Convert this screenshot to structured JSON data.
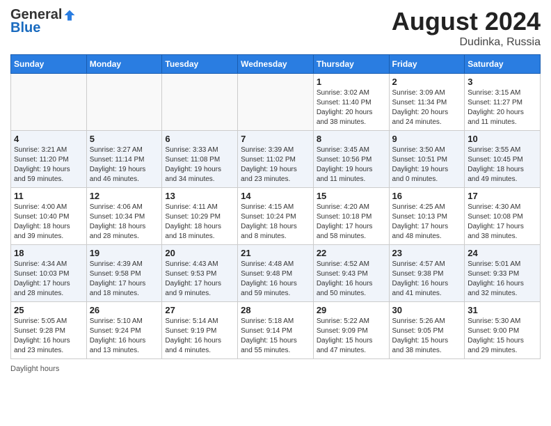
{
  "header": {
    "logo_general": "General",
    "logo_blue": "Blue",
    "month_year": "August 2024",
    "location": "Dudinka, Russia"
  },
  "days": [
    "Sunday",
    "Monday",
    "Tuesday",
    "Wednesday",
    "Thursday",
    "Friday",
    "Saturday"
  ],
  "weeks": [
    [
      {
        "date": "",
        "info": ""
      },
      {
        "date": "",
        "info": ""
      },
      {
        "date": "",
        "info": ""
      },
      {
        "date": "",
        "info": ""
      },
      {
        "date": "1",
        "info": "Sunrise: 3:02 AM\nSunset: 11:40 PM\nDaylight: 20 hours\nand 38 minutes."
      },
      {
        "date": "2",
        "info": "Sunrise: 3:09 AM\nSunset: 11:34 PM\nDaylight: 20 hours\nand 24 minutes."
      },
      {
        "date": "3",
        "info": "Sunrise: 3:15 AM\nSunset: 11:27 PM\nDaylight: 20 hours\nand 11 minutes."
      }
    ],
    [
      {
        "date": "4",
        "info": "Sunrise: 3:21 AM\nSunset: 11:20 PM\nDaylight: 19 hours\nand 59 minutes."
      },
      {
        "date": "5",
        "info": "Sunrise: 3:27 AM\nSunset: 11:14 PM\nDaylight: 19 hours\nand 46 minutes."
      },
      {
        "date": "6",
        "info": "Sunrise: 3:33 AM\nSunset: 11:08 PM\nDaylight: 19 hours\nand 34 minutes."
      },
      {
        "date": "7",
        "info": "Sunrise: 3:39 AM\nSunset: 11:02 PM\nDaylight: 19 hours\nand 23 minutes."
      },
      {
        "date": "8",
        "info": "Sunrise: 3:45 AM\nSunset: 10:56 PM\nDaylight: 19 hours\nand 11 minutes."
      },
      {
        "date": "9",
        "info": "Sunrise: 3:50 AM\nSunset: 10:51 PM\nDaylight: 19 hours\nand 0 minutes."
      },
      {
        "date": "10",
        "info": "Sunrise: 3:55 AM\nSunset: 10:45 PM\nDaylight: 18 hours\nand 49 minutes."
      }
    ],
    [
      {
        "date": "11",
        "info": "Sunrise: 4:00 AM\nSunset: 10:40 PM\nDaylight: 18 hours\nand 39 minutes."
      },
      {
        "date": "12",
        "info": "Sunrise: 4:06 AM\nSunset: 10:34 PM\nDaylight: 18 hours\nand 28 minutes."
      },
      {
        "date": "13",
        "info": "Sunrise: 4:11 AM\nSunset: 10:29 PM\nDaylight: 18 hours\nand 18 minutes."
      },
      {
        "date": "14",
        "info": "Sunrise: 4:15 AM\nSunset: 10:24 PM\nDaylight: 18 hours\nand 8 minutes."
      },
      {
        "date": "15",
        "info": "Sunrise: 4:20 AM\nSunset: 10:18 PM\nDaylight: 17 hours\nand 58 minutes."
      },
      {
        "date": "16",
        "info": "Sunrise: 4:25 AM\nSunset: 10:13 PM\nDaylight: 17 hours\nand 48 minutes."
      },
      {
        "date": "17",
        "info": "Sunrise: 4:30 AM\nSunset: 10:08 PM\nDaylight: 17 hours\nand 38 minutes."
      }
    ],
    [
      {
        "date": "18",
        "info": "Sunrise: 4:34 AM\nSunset: 10:03 PM\nDaylight: 17 hours\nand 28 minutes."
      },
      {
        "date": "19",
        "info": "Sunrise: 4:39 AM\nSunset: 9:58 PM\nDaylight: 17 hours\nand 18 minutes."
      },
      {
        "date": "20",
        "info": "Sunrise: 4:43 AM\nSunset: 9:53 PM\nDaylight: 17 hours\nand 9 minutes."
      },
      {
        "date": "21",
        "info": "Sunrise: 4:48 AM\nSunset: 9:48 PM\nDaylight: 16 hours\nand 59 minutes."
      },
      {
        "date": "22",
        "info": "Sunrise: 4:52 AM\nSunset: 9:43 PM\nDaylight: 16 hours\nand 50 minutes."
      },
      {
        "date": "23",
        "info": "Sunrise: 4:57 AM\nSunset: 9:38 PM\nDaylight: 16 hours\nand 41 minutes."
      },
      {
        "date": "24",
        "info": "Sunrise: 5:01 AM\nSunset: 9:33 PM\nDaylight: 16 hours\nand 32 minutes."
      }
    ],
    [
      {
        "date": "25",
        "info": "Sunrise: 5:05 AM\nSunset: 9:28 PM\nDaylight: 16 hours\nand 23 minutes."
      },
      {
        "date": "26",
        "info": "Sunrise: 5:10 AM\nSunset: 9:24 PM\nDaylight: 16 hours\nand 13 minutes."
      },
      {
        "date": "27",
        "info": "Sunrise: 5:14 AM\nSunset: 9:19 PM\nDaylight: 16 hours\nand 4 minutes."
      },
      {
        "date": "28",
        "info": "Sunrise: 5:18 AM\nSunset: 9:14 PM\nDaylight: 15 hours\nand 55 minutes."
      },
      {
        "date": "29",
        "info": "Sunrise: 5:22 AM\nSunset: 9:09 PM\nDaylight: 15 hours\nand 47 minutes."
      },
      {
        "date": "30",
        "info": "Sunrise: 5:26 AM\nSunset: 9:05 PM\nDaylight: 15 hours\nand 38 minutes."
      },
      {
        "date": "31",
        "info": "Sunrise: 5:30 AM\nSunset: 9:00 PM\nDaylight: 15 hours\nand 29 minutes."
      }
    ]
  ],
  "footer": {
    "daylight_label": "Daylight hours"
  }
}
